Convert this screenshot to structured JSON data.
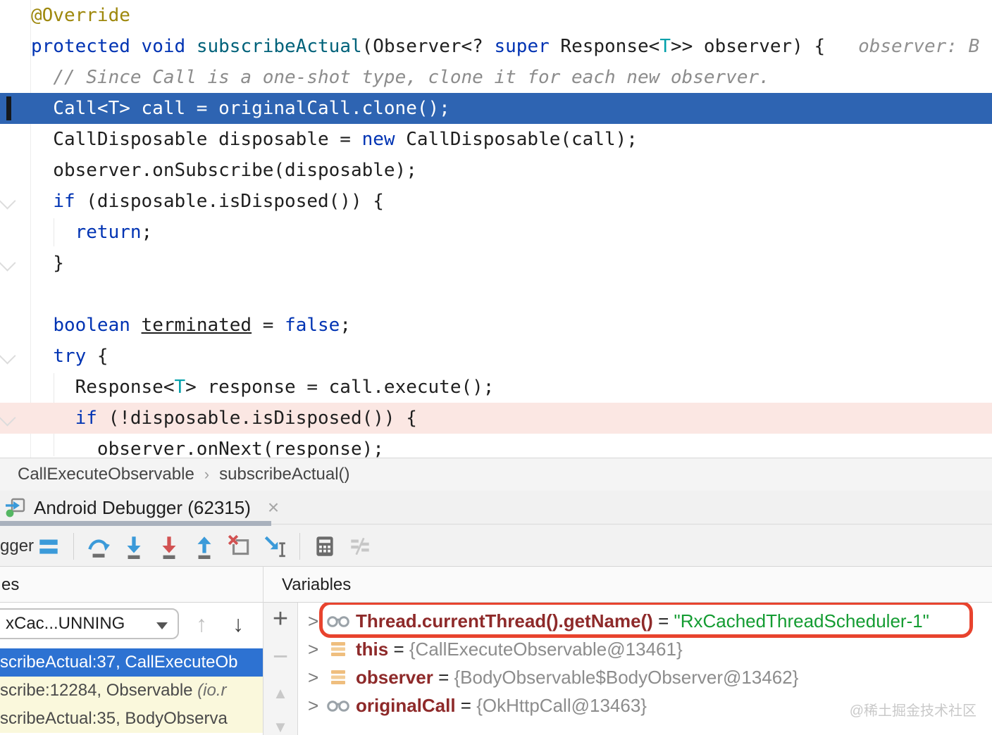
{
  "editor": {
    "lines": [
      [
        {
          "t": "@Override",
          "c": "ann"
        }
      ],
      [
        {
          "t": "protected",
          "c": "kw"
        },
        {
          "t": " ",
          "c": "plain"
        },
        {
          "t": "void",
          "c": "kw"
        },
        {
          "t": " ",
          "c": "plain"
        },
        {
          "t": "subscribeActual",
          "c": "method"
        },
        {
          "t": "(Observer<? ",
          "c": "plain"
        },
        {
          "t": "super",
          "c": "kw"
        },
        {
          "t": " Response<",
          "c": "plain"
        },
        {
          "t": "T",
          "c": "typeparam"
        },
        {
          "t": ">> observer) {",
          "c": "plain"
        },
        {
          "t": "   ",
          "c": "plain"
        },
        {
          "t": "observer: B",
          "c": "hint"
        }
      ],
      [
        {
          "t": "  ",
          "c": "plain"
        },
        {
          "t": "// Since Call is a one-shot type, clone it for each new observer.",
          "c": "comment"
        }
      ],
      [
        {
          "t": "  Call<T> call = originalCall.clone();",
          "c": "white"
        }
      ],
      [
        {
          "t": "  CallDisposable disposable = ",
          "c": "plain"
        },
        {
          "t": "new",
          "c": "kw"
        },
        {
          "t": " CallDisposable(call);",
          "c": "plain"
        }
      ],
      [
        {
          "t": "  observer.onSubscribe(disposable);",
          "c": "plain"
        }
      ],
      [
        {
          "t": "  ",
          "c": "plain"
        },
        {
          "t": "if",
          "c": "kw"
        },
        {
          "t": " (disposable.isDisposed()) {",
          "c": "plain"
        }
      ],
      [
        {
          "t": "    ",
          "c": "plain"
        },
        {
          "t": "return",
          "c": "kw"
        },
        {
          "t": ";",
          "c": "plain"
        }
      ],
      [
        {
          "t": "  }",
          "c": "plain"
        }
      ],
      [],
      [
        {
          "t": "  ",
          "c": "plain"
        },
        {
          "t": "boolean",
          "c": "kw"
        },
        {
          "t": " ",
          "c": "plain"
        },
        {
          "t": "terminated",
          "c": "underline"
        },
        {
          "t": " = ",
          "c": "plain"
        },
        {
          "t": "false",
          "c": "kw"
        },
        {
          "t": ";",
          "c": "plain"
        }
      ],
      [
        {
          "t": "  ",
          "c": "plain"
        },
        {
          "t": "try",
          "c": "kw"
        },
        {
          "t": " {",
          "c": "plain"
        }
      ],
      [
        {
          "t": "    Response<",
          "c": "plain"
        },
        {
          "t": "T",
          "c": "typeparam"
        },
        {
          "t": "> response = call.execute();",
          "c": "plain"
        }
      ],
      [
        {
          "t": "    ",
          "c": "plain"
        },
        {
          "t": "if",
          "c": "kw"
        },
        {
          "t": " (!disposable.isDisposed()) {",
          "c": "plain"
        }
      ],
      [
        {
          "t": "      observer.onNext(response);",
          "c": "plain"
        }
      ]
    ]
  },
  "breadcrumb": {
    "items": [
      "CallExecuteObservable",
      "subscribeActual()"
    ],
    "separator": "›"
  },
  "debug_tab": {
    "label": "Android Debugger (62315)",
    "close_glyph": "×"
  },
  "toolbar": {
    "partial_label": "gger",
    "icons": [
      "frames-view",
      "step-over",
      "step-into",
      "force-step-into",
      "step-out",
      "drop-frame",
      "run-to-cursor",
      "evaluate-expression",
      "layout-settings"
    ]
  },
  "frames_panel": {
    "header_partial": "es",
    "thread_selector_value": "xCac...UNNING",
    "nav_up_glyph": "↑",
    "nav_down_glyph": "↓",
    "rows": [
      {
        "selected": true,
        "segments": [
          {
            "t": "scribeActual:37, CallExecuteOb",
            "c": "frame-sel"
          }
        ]
      },
      {
        "selected": false,
        "segments": [
          {
            "t": "scribe:12284, Observable ",
            "c": "frame"
          },
          {
            "t": "(io.r",
            "c": "frame-italic"
          }
        ]
      },
      {
        "selected": false,
        "segments": [
          {
            "t": "scribeActual:35, BodyObserva",
            "c": "frame"
          }
        ]
      }
    ]
  },
  "watch_strip": {
    "add_glyph": "+",
    "remove_glyph": "−",
    "up_glyph": "▲",
    "down_glyph": "▼"
  },
  "variables_panel": {
    "header": "Variables",
    "expander_glyph": ">",
    "rows": [
      {
        "icon": "watch-glasses",
        "annotated": true,
        "segments": [
          {
            "t": "Thread.currentThread().getName()",
            "c": "varname"
          },
          {
            "t": " = ",
            "c": "eq"
          },
          {
            "t": "\"RxCachedThreadScheduler-1\"",
            "c": "string"
          }
        ]
      },
      {
        "icon": "field",
        "annotated": false,
        "segments": [
          {
            "t": "this",
            "c": "varname"
          },
          {
            "t": " = ",
            "c": "eq"
          },
          {
            "t": "{CallExecuteObservable@13461}",
            "c": "objval"
          }
        ]
      },
      {
        "icon": "field",
        "annotated": false,
        "segments": [
          {
            "t": "observer",
            "c": "varname"
          },
          {
            "t": " = ",
            "c": "eq"
          },
          {
            "t": "{BodyObservable$BodyObserver@13462}",
            "c": "objval"
          }
        ]
      },
      {
        "icon": "watch-glasses",
        "annotated": false,
        "segments": [
          {
            "t": "originalCall",
            "c": "varname"
          },
          {
            "t": " = ",
            "c": "eq"
          },
          {
            "t": "{OkHttpCall@13463}",
            "c": "objval"
          }
        ]
      }
    ]
  },
  "watermark": "@稀土掘金技术社区",
  "colors": {
    "execution_line_bg": "#2E64B2",
    "breakpoint_line_bg": "#FBE7E3",
    "keyword": "#0033B3",
    "method_decl": "#00627A",
    "annotation_olive": "#9E880D",
    "string_value_green": "#149C32",
    "variable_name_maroon": "#8E2A2A",
    "selected_frame_blue": "#2D72D2",
    "library_frame_yellow": "#FAF8DC",
    "red_annotation_box": "#E8432E",
    "icon_blue": "#3B9AD9",
    "icon_red": "#D25252"
  }
}
